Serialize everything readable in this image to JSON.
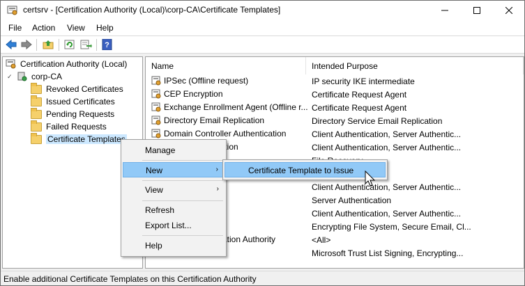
{
  "window": {
    "title": "certsrv - [Certification Authority (Local)\\corp-CA\\Certificate Templates]"
  },
  "menu": [
    "File",
    "Action",
    "View",
    "Help"
  ],
  "tree": {
    "root": "Certification Authority (Local)",
    "ca": "corp-CA",
    "folders": [
      "Revoked Certificates",
      "Issued Certificates",
      "Pending Requests",
      "Failed Requests",
      "Certificate Templates"
    ]
  },
  "list": {
    "columns": [
      "Name",
      "Intended Purpose"
    ],
    "rows": [
      {
        "name": "IPSec (Offline request)",
        "purpose": "IP security IKE intermediate"
      },
      {
        "name": "CEP Encryption",
        "purpose": "Certificate Request Agent"
      },
      {
        "name": "Exchange Enrollment Agent (Offline r...",
        "purpose": "Certificate Request Agent"
      },
      {
        "name": "Directory Email Replication",
        "purpose": "Directory Service Email Replication"
      },
      {
        "name": "Domain Controller Authentication",
        "purpose": "Client Authentication, Server Authentic..."
      },
      {
        "name": "ication",
        "purpose": "Client Authentication, Server Authentic..."
      },
      {
        "name": "",
        "purpose": "File Recovery"
      },
      {
        "name": "",
        "purpose": "m"
      },
      {
        "name": "er",
        "purpose": "Client Authentication, Server Authentic..."
      },
      {
        "name": "",
        "purpose": "Server Authentication"
      },
      {
        "name": "",
        "purpose": "Client Authentication, Server Authentic..."
      },
      {
        "name": "",
        "purpose": "Encrypting File System, Secure Email, Cl..."
      },
      {
        "name": "fication Authority",
        "purpose": "<All>"
      },
      {
        "name": "",
        "purpose": "Microsoft Trust List Signing, Encrypting..."
      }
    ]
  },
  "context_menu": {
    "items": [
      "Manage",
      "New",
      "View",
      "Refresh",
      "Export List...",
      "Help"
    ],
    "submenu_arrow": "›"
  },
  "submenu": {
    "item": "Certificate Template to Issue"
  },
  "status": "Enable additional Certificate Templates on this Certification Authority",
  "colors": {
    "highlight": "#91c9f7",
    "tree_selection": "#cce8ff",
    "folder": "#f5d06b"
  }
}
